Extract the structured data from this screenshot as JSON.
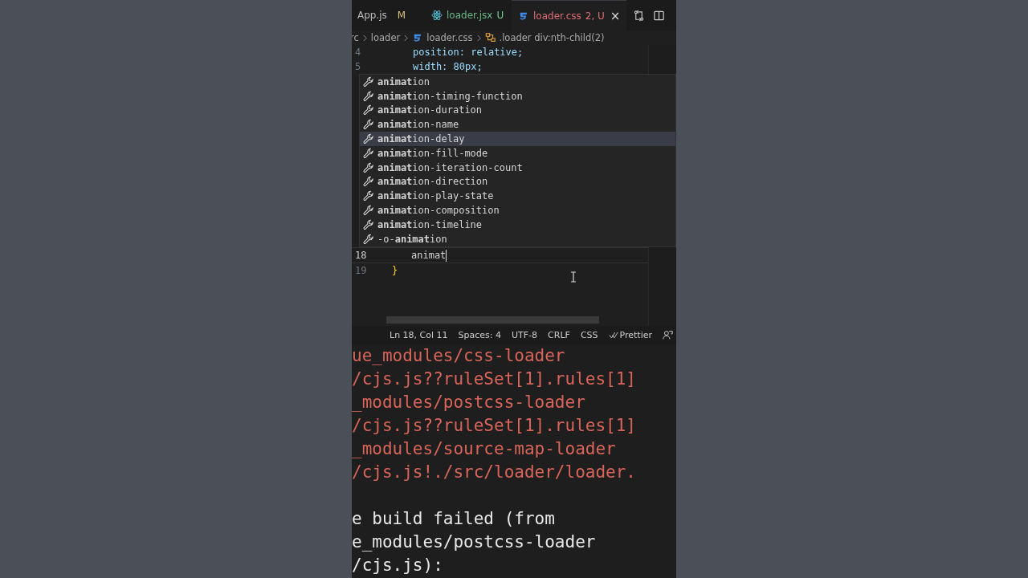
{
  "tabs": [
    {
      "label": "App.js",
      "badge": "M",
      "kind": "js",
      "selected": false
    },
    {
      "label": "loader.jsx",
      "badge": "U",
      "kind": "react",
      "selected": false
    },
    {
      "label": "loader.css",
      "badge": "2, U",
      "kind": "css",
      "selected": true
    }
  ],
  "tab_close": "×",
  "breadcrumbs": [
    {
      "label": "rc",
      "kind": "folder"
    },
    {
      "label": "loader",
      "kind": "folder"
    },
    {
      "label": "loader.css",
      "kind": "css"
    },
    {
      "label": ".loader div:nth-child(2)",
      "kind": "selector"
    }
  ],
  "code_lines": [
    {
      "number": "4",
      "text": "position: relative;"
    },
    {
      "number": "5",
      "text": "width: 80px;"
    }
  ],
  "suggestions": [
    {
      "label": "**animat**ion",
      "selected": false
    },
    {
      "label": "**animat**ion-timing-function",
      "selected": false
    },
    {
      "label": "**animat**ion-duration",
      "selected": false
    },
    {
      "label": "**animat**ion-name",
      "selected": false
    },
    {
      "label": "**animat**ion-delay",
      "selected": true
    },
    {
      "label": "**animat**ion-fill-mode",
      "selected": false
    },
    {
      "label": "**animat**ion-iteration-count",
      "selected": false
    },
    {
      "label": "**animat**ion-direction",
      "selected": false
    },
    {
      "label": "**animat**ion-play-state",
      "selected": false
    },
    {
      "label": "**animat**ion-composition",
      "selected": false
    },
    {
      "label": "**animat**ion-timeline",
      "selected": false
    },
    {
      "label": "-o-**animat**ion",
      "selected": false
    }
  ],
  "lower_lines": [
    {
      "number": "18",
      "text": "animat",
      "current": true
    },
    {
      "number": "19",
      "text": "}",
      "current": false
    }
  ],
  "status_bar": [
    "Ln 18, Col 11",
    "Spaces: 4",
    "UTF-8",
    "CRLF",
    "CSS",
    "Prettier"
  ],
  "terminal": [
    {
      "text": "ue_modules/css-loader",
      "kind": "error"
    },
    {
      "text": "/cjs.js??ruleSet[1].rules[1]",
      "kind": "error"
    },
    {
      "text": "_modules/postcss-loader",
      "kind": "error"
    },
    {
      "text": "/cjs.js??ruleSet[1].rules[1]",
      "kind": "error"
    },
    {
      "text": "_modules/source-map-loader",
      "kind": "error"
    },
    {
      "text": "/cjs.js!./src/loader/loader.",
      "kind": "error"
    },
    {
      "text": "e build failed (from",
      "kind": "plain"
    },
    {
      "text": "e_modules/postcss-loader",
      "kind": "plain"
    },
    {
      "text": "/cjs.js):",
      "kind": "plain"
    }
  ]
}
